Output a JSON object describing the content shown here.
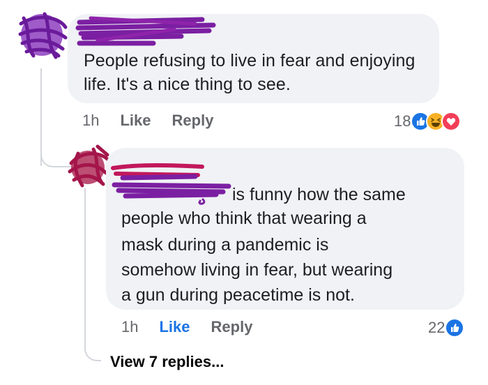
{
  "comments": [
    {
      "text": "People refusing to live in fear and enjoying life.  It's a nice thing to see.",
      "time": "1h",
      "like_label": "Like",
      "reply_label": "Reply",
      "reaction_count": "18",
      "reactions": [
        "like-icon",
        "haha-icon",
        "love-icon"
      ]
    },
    {
      "text_lines": [
        "is funny how the same",
        "people who think that wearing a",
        "mask during a pandemic is",
        "somehow living in fear, but wearing",
        "a gun during peacetime is not."
      ],
      "time": "1h",
      "like_label": "Like",
      "reply_label": "Reply",
      "reaction_count": "22",
      "reactions": [
        "like-icon"
      ]
    }
  ],
  "view_replies_label": "View 7 replies...",
  "colors": {
    "bubble": "#f0f2f5",
    "text": "#1c1e21",
    "meta": "#65676b",
    "like_blue": "#1b74e4",
    "scribble_purple": "#7b1fa2",
    "scribble_magenta": "#c2185b",
    "love_red": "#f33e58",
    "haha_yellow": "#f7b125"
  }
}
